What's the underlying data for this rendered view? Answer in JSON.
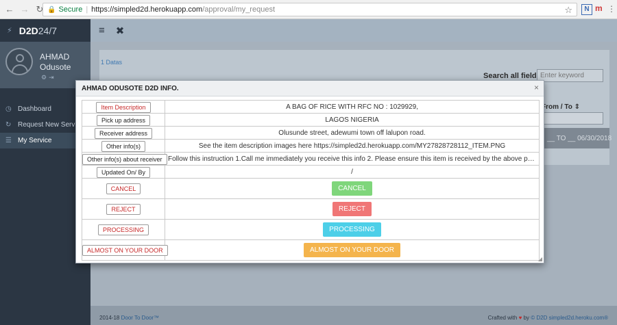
{
  "browser": {
    "secure_label": "Secure",
    "url_host": "https://simpled2d.herokuapp.com",
    "url_path": "/approval/my_request",
    "ext_n": "N",
    "ext_m": "m"
  },
  "sidebar": {
    "brand_bold": "D2D",
    "brand_rest": "24/7",
    "user_first": "AHMAD",
    "user_last": "Odusote",
    "items": [
      {
        "label": "Dashboard",
        "icon": "dashboard-icon"
      },
      {
        "label": "Request New Service",
        "icon": "refresh-icon"
      },
      {
        "label": "My Service",
        "icon": "list-icon"
      }
    ]
  },
  "main": {
    "datas_count": "1 Datas",
    "search_label": "Search all fields:",
    "search_placeholder": "Enter keyword",
    "col_from_to": "From / To ⇕",
    "row_dates": "__ TO __ 06/30/2018"
  },
  "footer": {
    "left_year": "2014-18",
    "left_link": "Door To Door™",
    "right_text": "Crafted with",
    "right_by": "by",
    "right_link": "© D2D simpled2d.heroku.com®"
  },
  "modal": {
    "title": "AHMAD ODUSOTE D2D INFO.",
    "rows": [
      {
        "label": "Item Description",
        "value": "A BAG OF RICE WITH RFC NO : 1029929,"
      },
      {
        "label": "Pick up address",
        "value": "LAGOS NIGERIA"
      },
      {
        "label": "Receiver address",
        "value": "Olusunde street, adewumi town off lalupon road."
      },
      {
        "label": "Other info(s)",
        "value": "See the item description images here https://simpled2d.herokuapp.com/MY27828728112_ITEM.PNG"
      },
      {
        "label": "Other info(s) about receiver",
        "value": "Follow this instruction 1.Call me immediately you receive this info 2. Please ensure this item is received by the above person ..."
      },
      {
        "label": "Updated On/ By",
        "value": "/"
      }
    ],
    "actions": [
      {
        "label": "CANCEL",
        "button": "CANCEL"
      },
      {
        "label": "REJECT",
        "button": "REJECT"
      },
      {
        "label": "PROCESSING",
        "button": "PROCESSING"
      },
      {
        "label": "ALMOST ON YOUR DOOR",
        "button": "ALMOST ON YOUR DOOR"
      }
    ]
  },
  "colors": {
    "sidebar_bg": "#2b3643",
    "cancel": "#7fd67b",
    "reject": "#f07676",
    "processing": "#4dcfe8",
    "almost": "#f4b44c"
  }
}
